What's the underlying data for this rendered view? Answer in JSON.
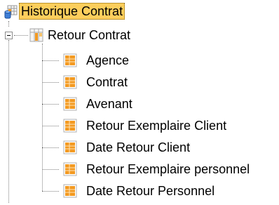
{
  "tree": {
    "root": {
      "label": "Historique Contrat",
      "selected": true,
      "icon": "table-database-icon"
    },
    "group": {
      "label": "Retour Contrat",
      "expanded": true,
      "icon": "table-group-icon",
      "expander": "minus"
    },
    "fields": [
      {
        "label": "Agence",
        "icon": "field-icon"
      },
      {
        "label": "Contrat",
        "icon": "field-icon"
      },
      {
        "label": "Avenant",
        "icon": "field-icon"
      },
      {
        "label": "Retour Exemplaire Client",
        "icon": "field-icon"
      },
      {
        "label": "Date Retour Client",
        "icon": "field-icon"
      },
      {
        "label": "Retour Exemplaire personnel",
        "icon": "field-icon"
      },
      {
        "label": "Date Retour Personnel",
        "icon": "field-icon"
      }
    ]
  },
  "colors": {
    "selection_bg": "#fdce5c",
    "connector": "#808080",
    "field_icon_orange": "#f39a22",
    "field_icon_frame": "#b0b0b0"
  }
}
